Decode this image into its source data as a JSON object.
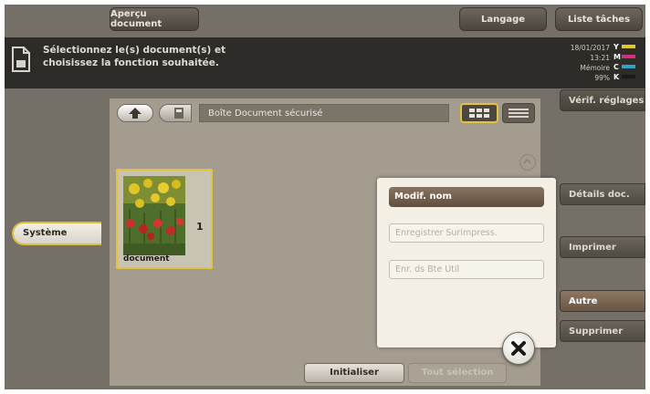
{
  "header": {
    "preview_tab": "Aperçu document",
    "language_tab": "Langage",
    "job_list_tab": "Liste tâches",
    "message": "Sélectionnez le(s) document(s) et\nchoisissez la fonction souhaitée.",
    "date": "18/01/2017",
    "time": "13:21",
    "memory_label": "Mémoire",
    "memory_value": "99%",
    "toner": [
      "Y",
      "M",
      "C",
      "K"
    ],
    "toner_colors": [
      "#e3c81f",
      "#d2307a",
      "#2fa3c9",
      "#2a2a2a"
    ]
  },
  "panel": {
    "path": "Boîte Document sécurisé",
    "document": {
      "name": "document",
      "count": "1"
    }
  },
  "popup": {
    "rename": "Modif. nom",
    "save_overlay": "Enregistrer Surimpress.",
    "save_user_box": "Enr. ds Bte Util"
  },
  "bottom": {
    "reset": "Initialiser",
    "select_all": "Tout sélection"
  },
  "left": {
    "system_tab": "Système"
  },
  "right": {
    "check_settings": "Vérif. réglages",
    "doc_details": "Détails doc.",
    "print": "Imprimer",
    "other": "Autre",
    "delete": "Supprimer"
  }
}
